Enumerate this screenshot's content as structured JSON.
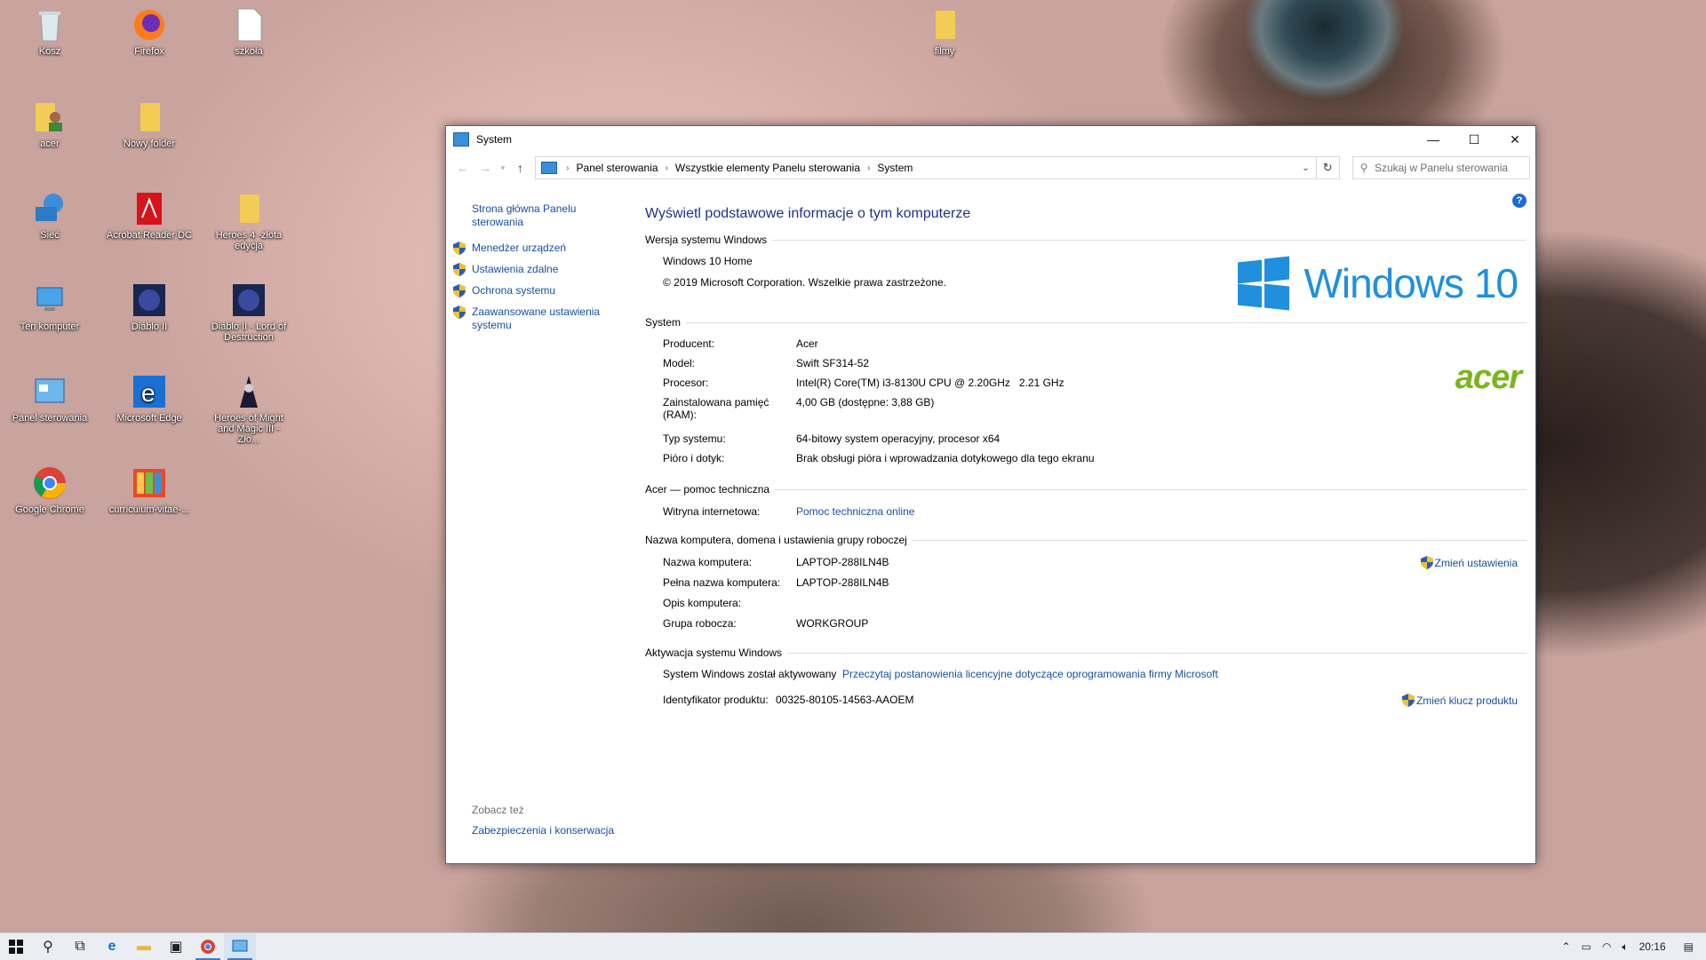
{
  "desktop": {
    "icons": [
      {
        "label": "Kosz",
        "icon": "recycle-bin-icon"
      },
      {
        "label": "Firefox",
        "icon": "firefox-icon"
      },
      {
        "label": "szkoła",
        "icon": "file-icon"
      },
      {
        "label": "filmy",
        "icon": "folder-icon"
      },
      {
        "label": "acer",
        "icon": "user-folder-icon"
      },
      {
        "label": "Nowy folder",
        "icon": "folder-icon"
      },
      {
        "label": "Sieć",
        "icon": "network-icon"
      },
      {
        "label": "Acrobat Reader DC",
        "icon": "acrobat-icon"
      },
      {
        "label": "Heroes 4 -złota edycja",
        "icon": "folder-icon"
      },
      {
        "label": "Ten komputer",
        "icon": "computer-icon"
      },
      {
        "label": "Diablo II",
        "icon": "diablo-icon"
      },
      {
        "label": "Diablo II - Lord of Destruction",
        "icon": "diablo-icon"
      },
      {
        "label": "Panel sterowania",
        "icon": "control-panel-icon"
      },
      {
        "label": "Microsoft Edge",
        "icon": "edge-icon"
      },
      {
        "label": "Heroes of Might and Magic III - Zło...",
        "icon": "heroes-icon"
      },
      {
        "label": "Google Chrome",
        "icon": "chrome-icon"
      },
      {
        "label": "curriculum-vitae-...",
        "icon": "cv-icon"
      }
    ]
  },
  "window": {
    "title": "System",
    "controls": {
      "minimize": "—",
      "maximize": "☐",
      "close": "✕"
    },
    "breadcrumb": [
      "Panel sterowania",
      "Wszystkie elementy Panelu sterowania",
      "System"
    ],
    "search_placeholder": "Szukaj w Panelu sterowania"
  },
  "left_pane": {
    "home": "Strona główna Panelu sterowania",
    "links": [
      "Menedżer urządzeń",
      "Ustawienia zdalne",
      "Ochrona systemu",
      "Zaawansowane ustawienia systemu"
    ],
    "see_also": "Zobacz też",
    "security": "Zabezpieczenia i konserwacja"
  },
  "main": {
    "title": "Wyświetl podstawowe informacje o tym komputerze",
    "help": "?",
    "edition": {
      "header": "Wersja systemu Windows",
      "name": "Windows 10 Home",
      "copyright": "© 2019 Microsoft Corporation. Wszelkie prawa zastrzeżone.",
      "logo_text": "Windows 10"
    },
    "system": {
      "header": "System",
      "oem_logo": "acer",
      "rows": [
        {
          "label": "Producent:",
          "value": "Acer"
        },
        {
          "label": "Model:",
          "value": "Swift SF314-52"
        },
        {
          "label": "Procesor:",
          "value": "Intel(R) Core(TM) i3-8130U CPU @ 2.20GHz   2.21 GHz"
        },
        {
          "label": "Zainstalowana pamięć (RAM):",
          "value": "4,00 GB (dostępne: 3,88 GB)"
        },
        {
          "label": "Typ systemu:",
          "value": "64-bitowy system operacyjny, procesor x64"
        },
        {
          "label": "Pióro i dotyk:",
          "value": "Brak obsługi pióra i wprowadzania dotykowego dla tego ekranu"
        }
      ]
    },
    "support": {
      "header": "Acer — pomoc techniczna",
      "label": "Witryna internetowa:",
      "link": "Pomoc techniczna online"
    },
    "computer_name": {
      "header": "Nazwa komputera, domena i ustawienia grupy roboczej",
      "change": "Zmień ustawienia",
      "rows": [
        {
          "label": "Nazwa komputera:",
          "value": "LAPTOP-288ILN4B"
        },
        {
          "label": "Pełna nazwa komputera:",
          "value": "LAPTOP-288ILN4B"
        },
        {
          "label": "Opis komputera:",
          "value": ""
        },
        {
          "label": "Grupa robocza:",
          "value": "WORKGROUP"
        }
      ]
    },
    "activation": {
      "header": "Aktywacja systemu Windows",
      "status": "System Windows został aktywowany",
      "license_link": "Przeczytaj postanowienia licencyjne dotyczące oprogramowania firmy Microsoft",
      "product_id_label": "Identyfikator produktu:",
      "product_id": "00325-80105-14563-AAOEM",
      "change_key": "Zmień klucz produktu"
    }
  },
  "taskbar": {
    "items": [
      "start-icon",
      "search-icon",
      "task-view-icon",
      "edge-icon",
      "file-explorer-icon",
      "store-icon",
      "chrome-icon",
      "control-panel-icon"
    ],
    "time": "20:16"
  }
}
